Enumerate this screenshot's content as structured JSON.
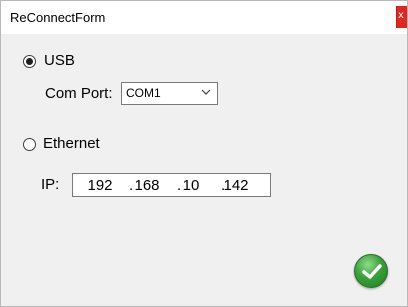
{
  "window": {
    "title": "ReConnectForm",
    "close_glyph": "x"
  },
  "connection": {
    "usb": {
      "label": "USB",
      "selected": true
    },
    "com_port": {
      "label": "Com Port:",
      "value": "COM1"
    },
    "ethernet": {
      "label": "Ethernet",
      "selected": false
    },
    "ip": {
      "label": "IP:",
      "octets": [
        "192",
        "168",
        "10",
        "142"
      ]
    }
  },
  "actions": {
    "ok_icon": "checkmark-icon"
  },
  "colors": {
    "close_button": "#e0271f",
    "ok_button": "#3aa13a",
    "window_background": "#f0f0f0"
  }
}
